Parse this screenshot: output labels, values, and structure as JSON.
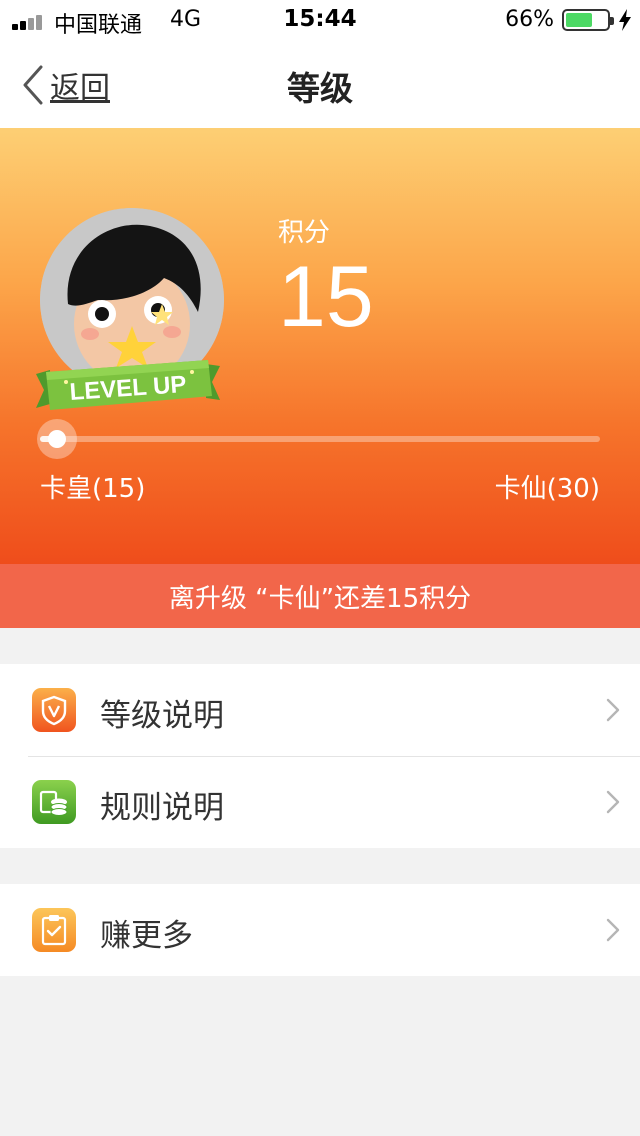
{
  "status_bar": {
    "carrier": "中国联通",
    "network": "4G",
    "time": "15:44",
    "battery_percent": "66%",
    "battery_level": 0.66
  },
  "nav": {
    "back_label": "返回",
    "title": "等级"
  },
  "header": {
    "points_label": "积分",
    "points_value": "15",
    "badge_text": "LEVEL UP",
    "current_level": "卡皇(15)",
    "next_level": "卡仙(30)",
    "progress": 0.03,
    "colors": {
      "top": "#fdcf74",
      "bottom": "#ef4d1b"
    }
  },
  "banner": {
    "text": "离升级 “卡仙”还差15积分"
  },
  "menu_groups": [
    [
      {
        "label": "等级说明",
        "icon": "shield-v-icon",
        "color": "#f6742b"
      },
      {
        "label": "规则说明",
        "icon": "coins-icon",
        "color": "#5ab53b"
      }
    ],
    [
      {
        "label": "赚更多",
        "icon": "clipboard-check-icon",
        "color": "#f9a23a"
      }
    ]
  ]
}
